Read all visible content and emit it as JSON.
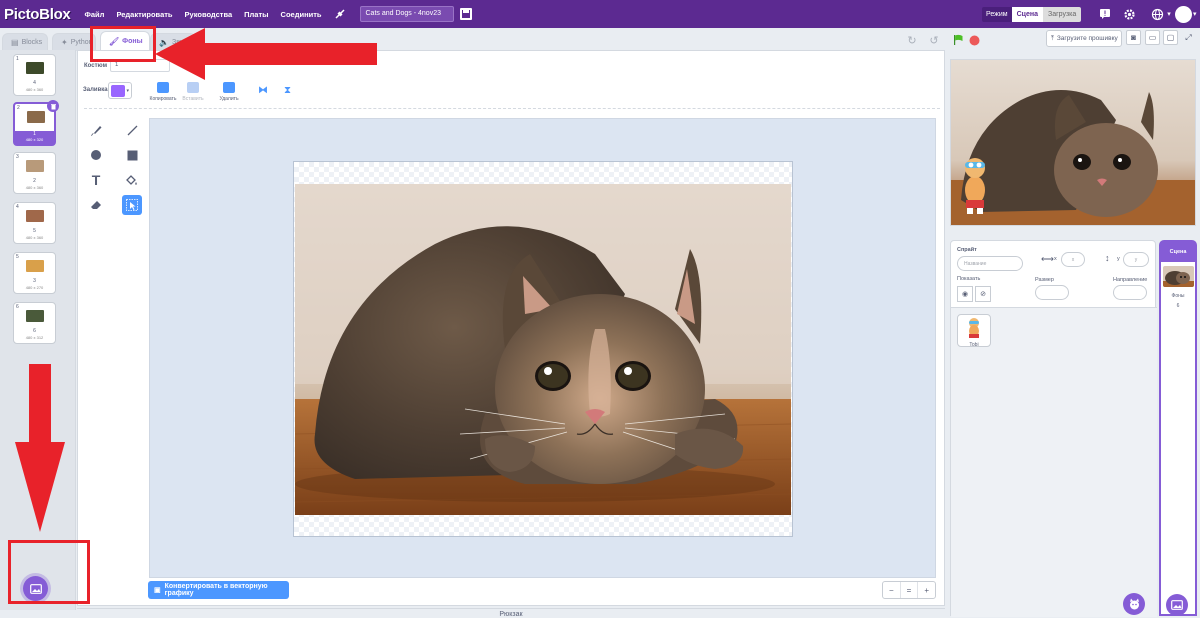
{
  "app": {
    "logo": "PictoBlox",
    "project_title": "Cats and Dogs - 4nov23"
  },
  "menu": [
    {
      "label": "Файл"
    },
    {
      "label": "Редактировать"
    },
    {
      "label": "Руководства"
    },
    {
      "label": "Платы"
    },
    {
      "label": "Соединить"
    }
  ],
  "mode": {
    "label": "Режим",
    "options": [
      "Сцена",
      "Загрузка"
    ],
    "selected": "Сцена"
  },
  "tabs": [
    {
      "label": "Blocks",
      "icon": "blocks-icon"
    },
    {
      "label": "Python",
      "icon": "python-icon"
    },
    {
      "label": "Фоны",
      "icon": "brush-icon",
      "active": true
    },
    {
      "label": "Звуки",
      "icon": "speaker-icon"
    }
  ],
  "toolbar_right": {
    "upload_firmware": "Загрузите прошивку"
  },
  "costumes": [
    {
      "num": "1",
      "name": "4",
      "size": "480 x 360",
      "color": "#3d4a2a"
    },
    {
      "num": "2",
      "name": "1",
      "size": "480 x 320",
      "color": "#8a6a4a",
      "selected": true
    },
    {
      "num": "3",
      "name": "2",
      "size": "480 x 360",
      "color": "#b89a7a"
    },
    {
      "num": "4",
      "name": "5",
      "size": "480 x 360",
      "color": "#a0684a"
    },
    {
      "num": "5",
      "name": "3",
      "size": "480 x 270",
      "color": "#d9a04a"
    },
    {
      "num": "6",
      "name": "6",
      "size": "480 x 312",
      "color": "#4a5a3a"
    }
  ],
  "editor": {
    "costume_label": "Костюм",
    "costume_value": "1",
    "fill_label": "Заливка",
    "fill_color": "#9966ff",
    "copy_label": "Копировать",
    "paste_label": "Вставить",
    "delete_label": "Удалить",
    "convert_button": "Конвертировать в векторную графику",
    "zoom_out": "−",
    "zoom_reset": "=",
    "zoom_in": "+"
  },
  "backpack": {
    "label": "Рюкзак"
  },
  "sprite_panel": {
    "sprite_label": "Спрайт",
    "name_placeholder": "Название",
    "x_label": "x",
    "x_placeholder": "x",
    "y_label": "y",
    "y_placeholder": "y",
    "show_label": "Показать",
    "size_label": "Размер",
    "direction_label": "Направление",
    "sprites": [
      {
        "name": "Tobi"
      }
    ]
  },
  "scene": {
    "header": "Сцена",
    "backdrops_label": "Фоны",
    "backdrops_count": "6"
  },
  "colors": {
    "brand": "#5c2a91",
    "accent": "#855cd6",
    "blue": "#4c97ff",
    "annotation_red": "#e8222a"
  }
}
